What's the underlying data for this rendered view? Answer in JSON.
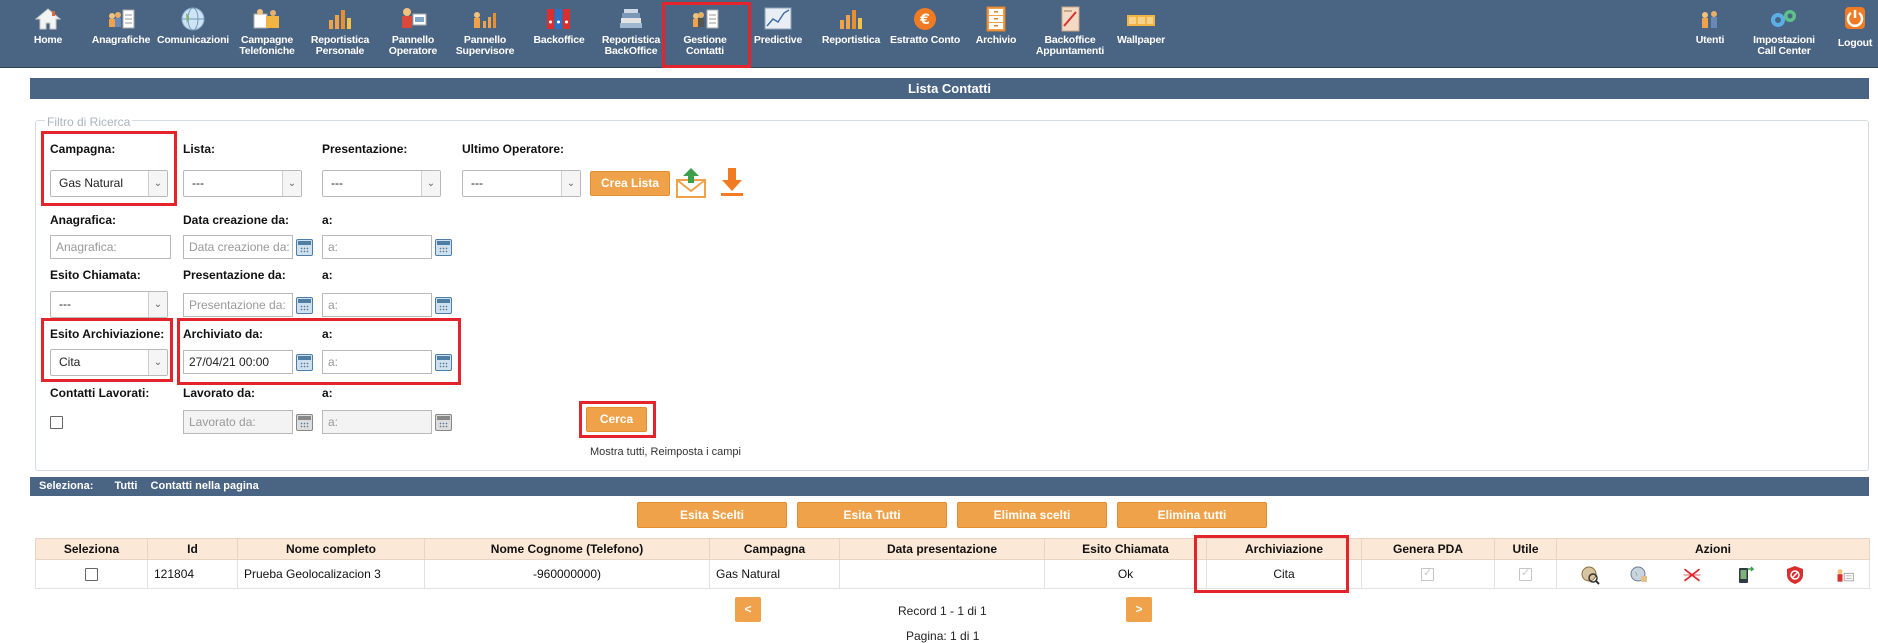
{
  "nav": {
    "left": [
      {
        "id": "home",
        "label": "Home",
        "icon": "home-icon"
      },
      {
        "id": "anagrafiche",
        "label": "Anagrafiche",
        "icon": "people-document-icon"
      },
      {
        "id": "comunicazioni",
        "label": "Comunicazioni",
        "icon": "globe-icon"
      },
      {
        "id": "campagne",
        "label": "Campagne\nTelefoniche",
        "icon": "campaign-icon"
      },
      {
        "id": "reportistica-personale",
        "label": "Reportistica\nPersonale",
        "icon": "bar-chart-icon"
      },
      {
        "id": "pannello-operatore",
        "label": "Pannello\nOperatore",
        "icon": "operator-panel-icon"
      },
      {
        "id": "pannello-supervisore",
        "label": "Pannello\nSupervisore",
        "icon": "supervisor-panel-icon"
      },
      {
        "id": "backoffice",
        "label": "Backoffice",
        "icon": "binders-icon"
      },
      {
        "id": "reportistica-backoffice",
        "label": "Reportistica\nBackOffice",
        "icon": "stacked-books-icon"
      },
      {
        "id": "gestione-contatti",
        "label": "Gestione\nContatti",
        "icon": "contacts-document-icon"
      },
      {
        "id": "predictive",
        "label": "Predictive",
        "icon": "line-chart-icon"
      },
      {
        "id": "reportistica",
        "label": "Reportistica",
        "icon": "bar-chart-icon"
      },
      {
        "id": "estratto-conto",
        "label": "Estratto Conto",
        "icon": "euro-icon"
      },
      {
        "id": "archivio",
        "label": "Archivio",
        "icon": "cabinet-icon"
      },
      {
        "id": "backoffice-appuntamenti",
        "label": "Backoffice\nAppuntamenti",
        "icon": "appointments-icon"
      },
      {
        "id": "wallpaper",
        "label": "Wallpaper",
        "icon": "wallpaper-icon"
      }
    ],
    "right": [
      {
        "id": "utenti",
        "label": "Utenti",
        "icon": "users-icon"
      },
      {
        "id": "impostazioni",
        "label": "Impostazioni\nCall Center",
        "icon": "gears-icon"
      },
      {
        "id": "logout",
        "label": "Logout",
        "icon": "power-icon"
      }
    ]
  },
  "panel": {
    "title": "Lista Contatti"
  },
  "filter": {
    "legend": "Filtro di Ricerca",
    "campagna": {
      "label": "Campagna:",
      "value": "Gas Natural"
    },
    "lista": {
      "label": "Lista:",
      "value": "---"
    },
    "presentazione": {
      "label": "Presentazione:",
      "value": "---"
    },
    "ultimo_operatore": {
      "label": "Ultimo Operatore:",
      "value": "---"
    },
    "crea_lista": "Crea Lista",
    "anagrafica": {
      "label": "Anagrafica:",
      "placeholder": "Anagrafica:"
    },
    "data_creazione_da": {
      "label": "Data creazione da:",
      "placeholder": "Data creazione da:"
    },
    "data_creazione_a": {
      "label": "a:",
      "placeholder": "a:"
    },
    "esito_chiamata": {
      "label": "Esito Chiamata:",
      "value": "---"
    },
    "presentazione_da": {
      "label": "Presentazione da:",
      "placeholder": "Presentazione da:"
    },
    "presentazione_a": {
      "label": "a:",
      "placeholder": "a:"
    },
    "esito_archiviazione": {
      "label": "Esito Archiviazione:",
      "value": "Cita"
    },
    "archiviato_da": {
      "label": "Archiviato da:",
      "value": "27/04/21 00:00"
    },
    "archiviato_a": {
      "label": "a:",
      "placeholder": "a:"
    },
    "contatti_lavorati": {
      "label": "Contatti Lavorati:"
    },
    "lavorato_da": {
      "label": "Lavorato da:",
      "placeholder": "Lavorato da:"
    },
    "lavorato_a": {
      "label": "a:",
      "placeholder": "a:"
    },
    "cerca": "Cerca",
    "links": "Mostra tutti, Reimposta i campi"
  },
  "selection": {
    "label": "Seleziona:",
    "all": "Tutti",
    "page": "Contatti nella pagina"
  },
  "actions": {
    "esita_scelti": "Esita Scelti",
    "esita_tutti": "Esita Tutti",
    "elimina_scelti": "Elimina scelti",
    "elimina_tutti": "Elimina tutti"
  },
  "table": {
    "headers": [
      "Seleziona",
      "Id",
      "Nome completo",
      "Nome Cognome (Telefono)",
      "Campagna",
      "Data presentazione",
      "Esito Chiamata",
      "Archiviazione",
      "Genera PDA",
      "Utile",
      "Azioni"
    ],
    "rows": [
      {
        "id": "121804",
        "nome_completo": "Prueba Geolocalizacion 3",
        "telefono": "-960000000)",
        "campagna": "Gas Natural",
        "data_presentazione": "",
        "esito": "Ok",
        "archiviazione": "Cita"
      }
    ]
  },
  "pager": {
    "prev": "<",
    "next": ">",
    "record": "Record 1 - 1 di 1",
    "pagina": "Pagina: 1 di 1"
  },
  "colors": {
    "nav_bg": "#4a6484",
    "accent": "#f0a24a",
    "highlight": "#e3242b",
    "table_header": "#fce8d6"
  }
}
